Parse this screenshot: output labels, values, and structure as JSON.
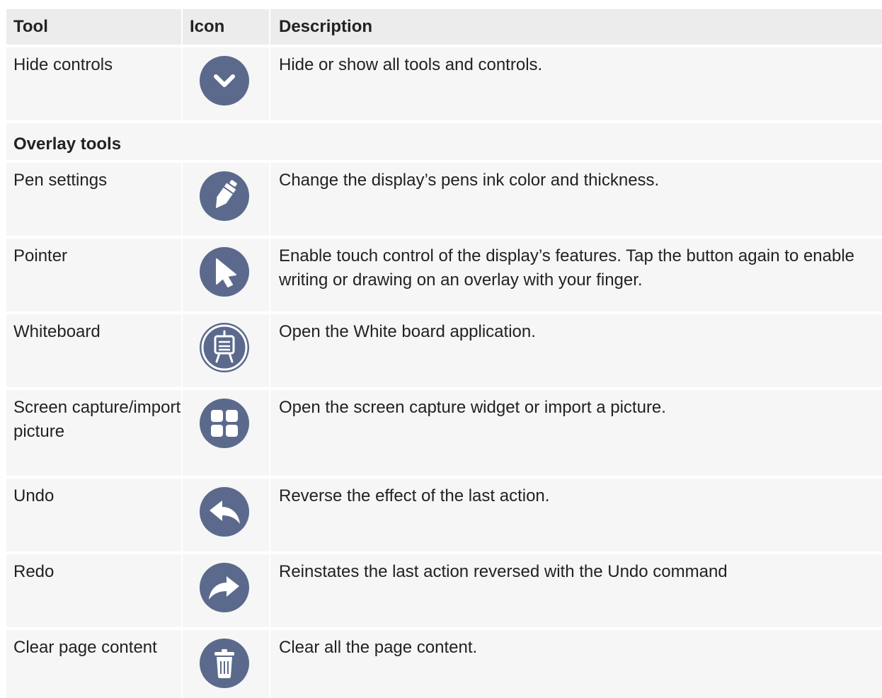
{
  "header": {
    "tool": "Tool",
    "icon": "Icon",
    "description": "Description"
  },
  "section_title": "Overlay tools",
  "rows": [
    {
      "tool": "Hide controls",
      "icon": "chevron-down-icon",
      "description": "Hide or show all tools and controls."
    },
    {
      "tool": "Pen settings",
      "icon": "pen-icon",
      "description": "Change the display’s pens ink color and thickness."
    },
    {
      "tool": "Pointer",
      "icon": "pointer-icon",
      "description": "Enable touch control of the display’s features. Tap the button again to enable writing or drawing on an overlay with your finger."
    },
    {
      "tool": "Whiteboard",
      "icon": "whiteboard-icon",
      "description": "Open the White board application."
    },
    {
      "tool": "Screen capture/import picture",
      "icon": "screen-capture-icon",
      "description": "Open the screen capture widget or import a picture."
    },
    {
      "tool": "Undo",
      "icon": "undo-icon",
      "description": "Reverse the effect of the last action."
    },
    {
      "tool": "Redo",
      "icon": "redo-icon",
      "description": "Reinstates the last action reversed with the Undo command"
    },
    {
      "tool": "Clear page content",
      "icon": "trash-icon",
      "description": "Clear all the page content."
    }
  ],
  "colors": {
    "icon_background": "#5b6a8c",
    "icon_foreground": "#ffffff",
    "cell_background": "#f6f6f6",
    "header_background": "#ececec",
    "text": "#222222"
  }
}
